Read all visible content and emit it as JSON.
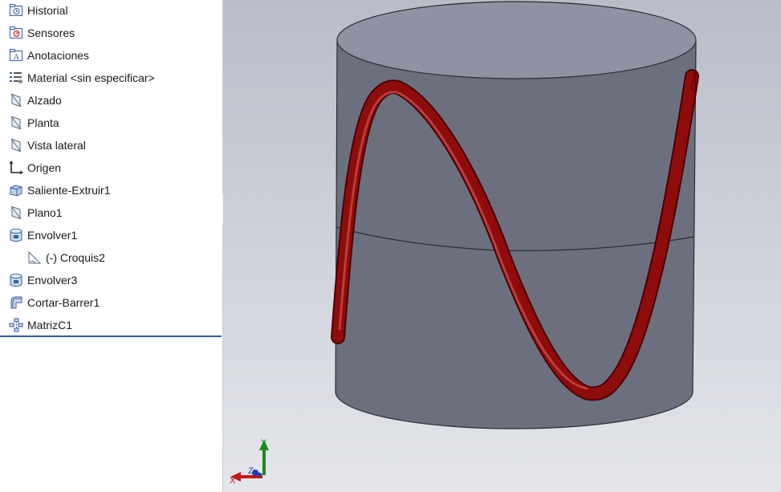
{
  "feature_tree": {
    "items": [
      {
        "label": "Historial",
        "icon": "history-icon"
      },
      {
        "label": "Sensores",
        "icon": "sensor-icon"
      },
      {
        "label": "Anotaciones",
        "icon": "annotations-icon"
      },
      {
        "label": "Material <sin especificar>",
        "icon": "material-icon"
      },
      {
        "label": "Alzado",
        "icon": "plane-icon"
      },
      {
        "label": "Planta",
        "icon": "plane-icon"
      },
      {
        "label": "Vista lateral",
        "icon": "plane-icon"
      },
      {
        "label": "Origen",
        "icon": "origin-icon"
      },
      {
        "label": "Saliente-Extruir1",
        "icon": "extrude-icon"
      },
      {
        "label": "Plano1",
        "icon": "plane-icon"
      },
      {
        "label": "Envolver1",
        "icon": "wrap-icon"
      },
      {
        "label": "(-) Croquis2",
        "icon": "sketch-icon"
      },
      {
        "label": "Envolver3",
        "icon": "wrap-icon"
      },
      {
        "label": "Cortar-Barrer1",
        "icon": "sweep-cut-icon"
      },
      {
        "label": "MatrizC1",
        "icon": "pattern-icon"
      }
    ]
  },
  "viewport": {
    "background_top": "#b9bdc8",
    "background_bottom": "#e4e6eb",
    "body_color": "#6c707e",
    "top_face_color": "#8e92a2",
    "curve_color": "#8f0c0c"
  },
  "triad": {
    "x_label": "X",
    "y_label": "Y",
    "z_label": "Z"
  }
}
